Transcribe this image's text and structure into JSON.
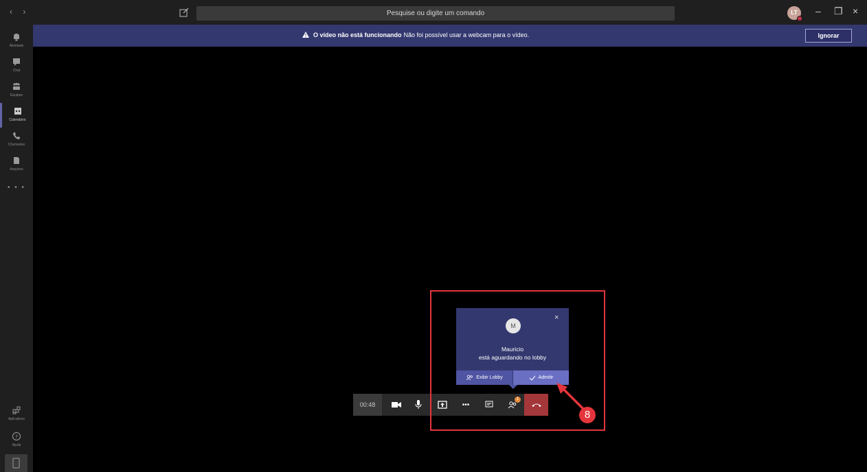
{
  "titlebar": {
    "nav": "‹ ›",
    "search_placeholder": "Pesquise ou digite um comando",
    "avatar_initials": "LT",
    "minimize": "–",
    "restore": "❐",
    "close": "×"
  },
  "rail": {
    "items": [
      {
        "label": "Atividade",
        "icon": "bell-icon"
      },
      {
        "label": "Chat",
        "icon": "chat-icon"
      },
      {
        "label": "Equipes",
        "icon": "teams-icon"
      },
      {
        "label": "Calendário",
        "icon": "calendar-icon",
        "active": true
      },
      {
        "label": "Chamadas",
        "icon": "phone-icon"
      },
      {
        "label": "Arquivos",
        "icon": "files-icon"
      }
    ],
    "more": "• • •",
    "bottom": [
      {
        "label": "Aplicativos",
        "icon": "apps-icon"
      },
      {
        "label": "Ajuda",
        "icon": "help-icon"
      }
    ]
  },
  "banner": {
    "title": "O vídeo não está funcionando",
    "message": "Não foi possível usar a webcam para o vídeo.",
    "button": "Ignorar"
  },
  "call": {
    "timer": "00:48",
    "participants_badge": "1",
    "more": "•••"
  },
  "lobby": {
    "avatar": "M",
    "name": "Mauricio",
    "status": "está aguardando no lobby",
    "view_lobby": "Exibir Lobby",
    "admit": "Admitir",
    "close": "×"
  },
  "annotation": {
    "step": "8"
  },
  "colors": {
    "accent": "#6264a7",
    "banner": "#33386f",
    "hangup": "#a4373a",
    "annotation": "#e5353c"
  }
}
